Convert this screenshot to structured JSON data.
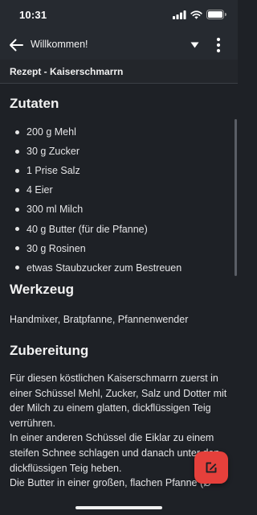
{
  "status_bar": {
    "time": "10:31"
  },
  "app_bar": {
    "title": "Willkommen!",
    "icons": {
      "back": "arrow-left-icon",
      "dropdown": "triangle-down-icon",
      "more": "more-vertical-icon"
    }
  },
  "subheader": {
    "title": "Rezept - Kaiserschmarrn"
  },
  "recipe": {
    "ingredients_heading": "Zutaten",
    "ingredients": [
      "200 g Mehl",
      "30 g Zucker",
      "1 Prise Salz",
      "4 Eier",
      "300 ml Milch",
      "40 g Butter (für die Pfanne)",
      "30 g Rosinen",
      "etwas Staubzucker zum Bestreuen"
    ],
    "tools_heading": "Werkzeug",
    "tools": "Handmixer, Bratpfanne, Pfannenwender",
    "preparation_heading": "Zubereitung",
    "preparation": "Für diesen köstlichen Kaiserschmarrn zuerst in einer Schüssel Mehl, Zucker, Salz und Dotter mit der Milch zu einem glatten, dickflüssigen Teig verrühren.\nIn einer anderen Schüssel die Eiklar zu einem steifen Schnee schlagen und danach unter den dickflüssigen Teig heben.\nDie Butter in einer großen, flachen Pfanne (Ø"
  },
  "fab": {
    "icon": "edit-icon"
  },
  "colors": {
    "background": "#1e2126",
    "app_bar": "#262a30",
    "accent": "#e5403b",
    "text": "#e8e8ea"
  }
}
